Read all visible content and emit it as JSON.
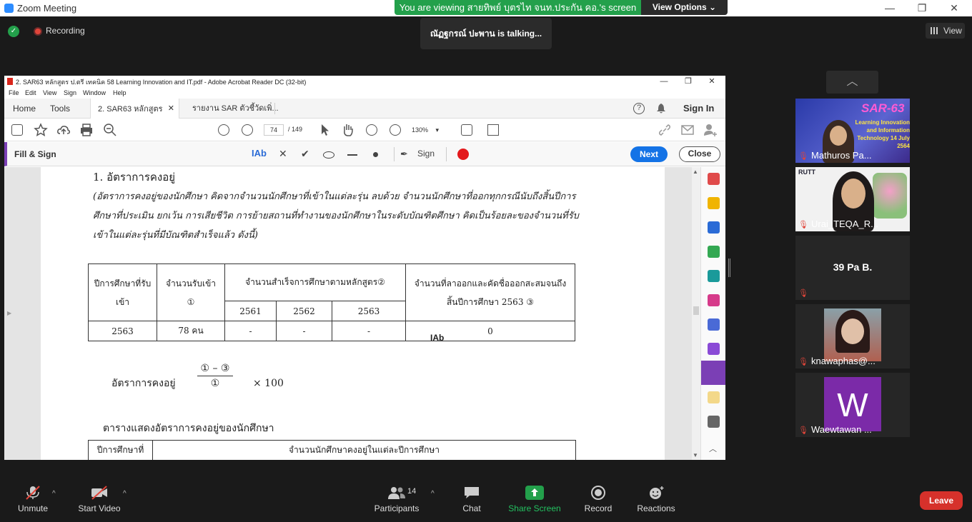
{
  "zoom": {
    "window_title": "Zoom Meeting",
    "banner_text": "You are viewing สายทิพย์ บุตรไท จนท.ประกัน คอ.'s screen",
    "view_options": "View Options",
    "recording": "Recording",
    "talking": "ณัฏฐกรณ์ ปะพาน is  talking...",
    "view": "View"
  },
  "acrobat": {
    "title": "2. SAR63 หลักสูตร ป.ตรี เทคนิค 58 Learning Innovation and IT.pdf - Adobe Acrobat Reader DC (32-bit)",
    "menu": [
      "File",
      "Edit",
      "View",
      "Sign",
      "Window",
      "Help"
    ],
    "tabs": [
      "Home",
      "Tools",
      "2. SAR63 หลักสูตร ป...",
      "รายงาน SAR ตัวชี้วัดเพิ่..."
    ],
    "sign_in": "Sign In",
    "page_current": "74",
    "page_total": "/ 149",
    "zoom_level": "130%",
    "fill_sign": {
      "title": "Fill & Sign",
      "text_tool": "IAb",
      "sign": "Sign",
      "next": "Next",
      "close": "Close",
      "ink_color": "#e3191c"
    }
  },
  "document": {
    "heading": "1.  อัตราการคงอยู่",
    "paragraph": "(อัตราการคงอยู่ของนักศึกษา  คิดจากจำนวนนักศึกษาที่เข้าในแต่ละรุ่น ลบด้วย จำนวนนักศึกษาที่ออกทุกกรณีนับถึงสิ้นปีการศึกษาที่ประเมิน ยกเว้น การเสียชีวิต การย้ายสถานที่ทำงานของนักศึกษาในระดับบัณฑิตศึกษา คิดเป็นร้อยละของจำนวนที่รับเข้าในแต่ละรุ่นที่มีบัณฑิตสำเร็จแล้ว ดังนี้)",
    "table1": {
      "h_year": "ปีการศึกษาที่รับเข้า",
      "h_admit": "จำนวนรับเข้า ①",
      "h_grad": "จำนวนสำเร็จการศึกษาตามหลักสูตร②",
      "h_drop": "จำนวนที่ลาออกและคัดชื่อออกสะสมจนถึงสิ้นปีการศึกษา 2563 ③",
      "years": [
        "2561",
        "2562",
        "2563"
      ],
      "row": [
        "2563",
        "78 คน",
        "-",
        "-",
        "-",
        "0"
      ]
    },
    "formula_label": "อัตราการคงอยู่",
    "formula_num": "① – ③",
    "formula_den": "①",
    "formula_mult": "×  100",
    "heading2": "ตารางแสดงอัตราการคงอยู่ของนักศึกษา",
    "table2": {
      "h_year": "ปีการศึกษาที่",
      "h_count": "จำนวนนักศึกษาคงอยู่ในแต่ละปีการศึกษา"
    },
    "cursor_label": "IAb"
  },
  "participants": {
    "tiles": [
      {
        "name": "Mathuros Pa...",
        "banner": "SAR-63",
        "banner_sub": "Learning Innovation and Information Technology 14 July 2564"
      },
      {
        "name": "Urai_TEQA_R...",
        "logo": "RUTT"
      },
      {
        "name": "",
        "big": "39  Pa B."
      },
      {
        "name": "knawaphas@..."
      },
      {
        "name": "Waewtawan ...",
        "initial": "W"
      }
    ]
  },
  "controls": {
    "unmute": "Unmute",
    "start_video": "Start Video",
    "participants": "Participants",
    "participants_count": "14",
    "chat": "Chat",
    "share_screen": "Share Screen",
    "record": "Record",
    "reactions": "Reactions",
    "leave": "Leave"
  }
}
